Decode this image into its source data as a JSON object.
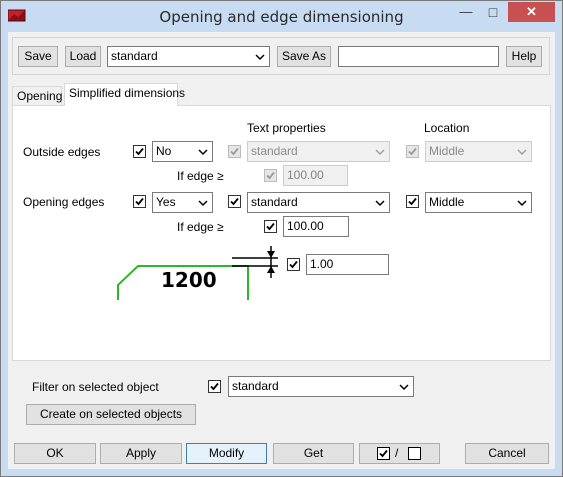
{
  "window": {
    "title": "Opening and edge dimensioning",
    "minimize": "—",
    "maximize": "□",
    "close": "✕"
  },
  "toolbar": {
    "save_label": "Save",
    "load_label": "Load",
    "preset_value": "standard",
    "save_as_label": "Save As",
    "save_as_value": "",
    "help_label": "Help"
  },
  "tabs": [
    {
      "label": "Opening"
    },
    {
      "label": "Simplified dimensions"
    }
  ],
  "panel": {
    "text_properties_header": "Text properties",
    "location_header": "Location",
    "outside_edges": {
      "label": "Outside edges",
      "checked": true,
      "value": "No",
      "text_checked": true,
      "text_value": "standard",
      "location_checked": true,
      "location_value": "Middle",
      "if_edge_label": "If edge ≥",
      "if_edge_checked": true,
      "if_edge_value": "100.00"
    },
    "opening_edges": {
      "label": "Opening edges",
      "checked": true,
      "value": "Yes",
      "text_checked": true,
      "text_value": "standard",
      "location_checked": true,
      "location_value": "Middle",
      "if_edge_label": "If edge ≥",
      "if_edge_checked": true,
      "if_edge_value": "100.00"
    },
    "preview_dimension": "1200",
    "offset_checked": true,
    "offset_value": "1.00"
  },
  "filter": {
    "label": "Filter on selected object",
    "checked": true,
    "value": "standard",
    "create_label": "Create on selected objects"
  },
  "bottom": {
    "ok": "OK",
    "apply": "Apply",
    "modify": "Modify",
    "get": "Get",
    "toggle_separator": "/",
    "cancel": "Cancel"
  },
  "colors": {
    "preview_outline": "#2ab82a",
    "title_bar": "#c7dbf2",
    "close_button": "#c75050"
  }
}
